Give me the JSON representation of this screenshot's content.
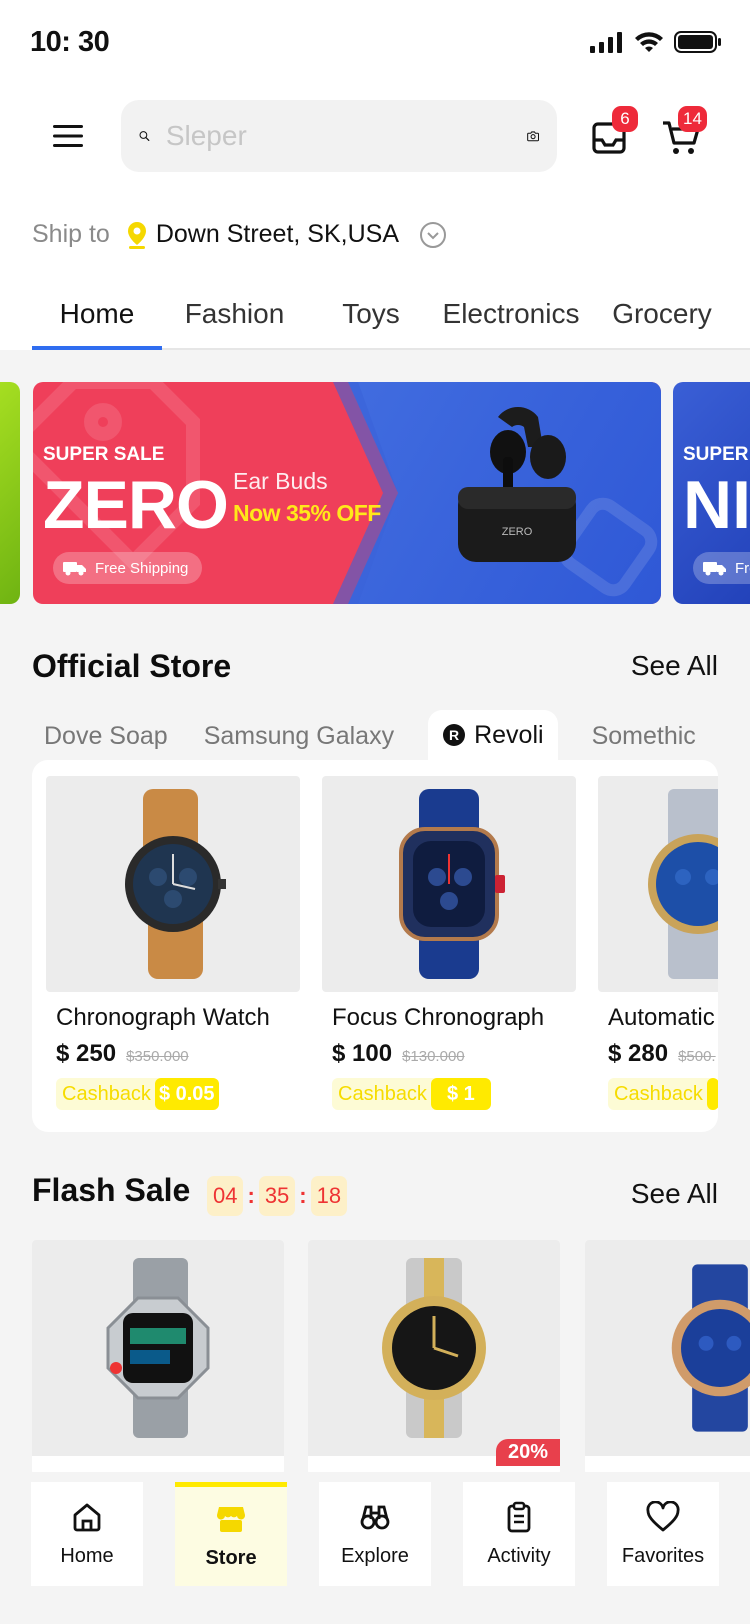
{
  "status_bar": {
    "time": "10: 30"
  },
  "header": {
    "search_placeholder": "Sleper",
    "inbox_badge": "6",
    "cart_badge": "14"
  },
  "ship": {
    "label": "Ship to",
    "address": "Down Street, SK,USA"
  },
  "categories": [
    "Home",
    "Fashion",
    "Toys",
    "Electronics",
    "Grocery"
  ],
  "banner": {
    "tag": "SUPER SALE",
    "brand": "ZERO",
    "product": "Ear Buds",
    "offer": "Now 35% OFF",
    "shipping": "Free Shipping",
    "case_label": "ZERO",
    "next_tag": "SUPER",
    "next_brand": "NI",
    "next_shipping": "Fre"
  },
  "official_store": {
    "title": "Official Store",
    "see_all": "See All",
    "tabs": [
      "Dove Soap",
      "Samsung Galaxy",
      "Revoli",
      "Somethic"
    ],
    "products": [
      {
        "name": "Chronograph Watch",
        "price": "$ 250",
        "old_price": "$350.000",
        "cashback_label": "Cashback",
        "cashback_value": "$ 0.05"
      },
      {
        "name": "Focus Chronograph",
        "price": "$ 100",
        "old_price": "$130.000",
        "cashback_label": "Cashback",
        "cashback_value": "$ 1"
      },
      {
        "name": "Automatic",
        "price": "$ 280",
        "old_price": "$500.",
        "cashback_label": "Cashback",
        "cashback_value": ""
      }
    ]
  },
  "flash_sale": {
    "title": "Flash Sale",
    "see_all": "See All",
    "timer": [
      "04",
      "35",
      "18"
    ],
    "discount_badge": "20%"
  },
  "bottom_nav": [
    {
      "label": "Home",
      "icon": "home-icon"
    },
    {
      "label": "Store",
      "icon": "store-icon"
    },
    {
      "label": "Explore",
      "icon": "binoculars-icon"
    },
    {
      "label": "Activity",
      "icon": "clipboard-icon"
    },
    {
      "label": "Favorites",
      "icon": "heart-icon"
    }
  ],
  "colors": {
    "accent_blue": "#2f6df0",
    "accent_yellow": "#ffea00",
    "banner_red": "#ef3f5a",
    "badge_red": "#ee2a3a"
  }
}
